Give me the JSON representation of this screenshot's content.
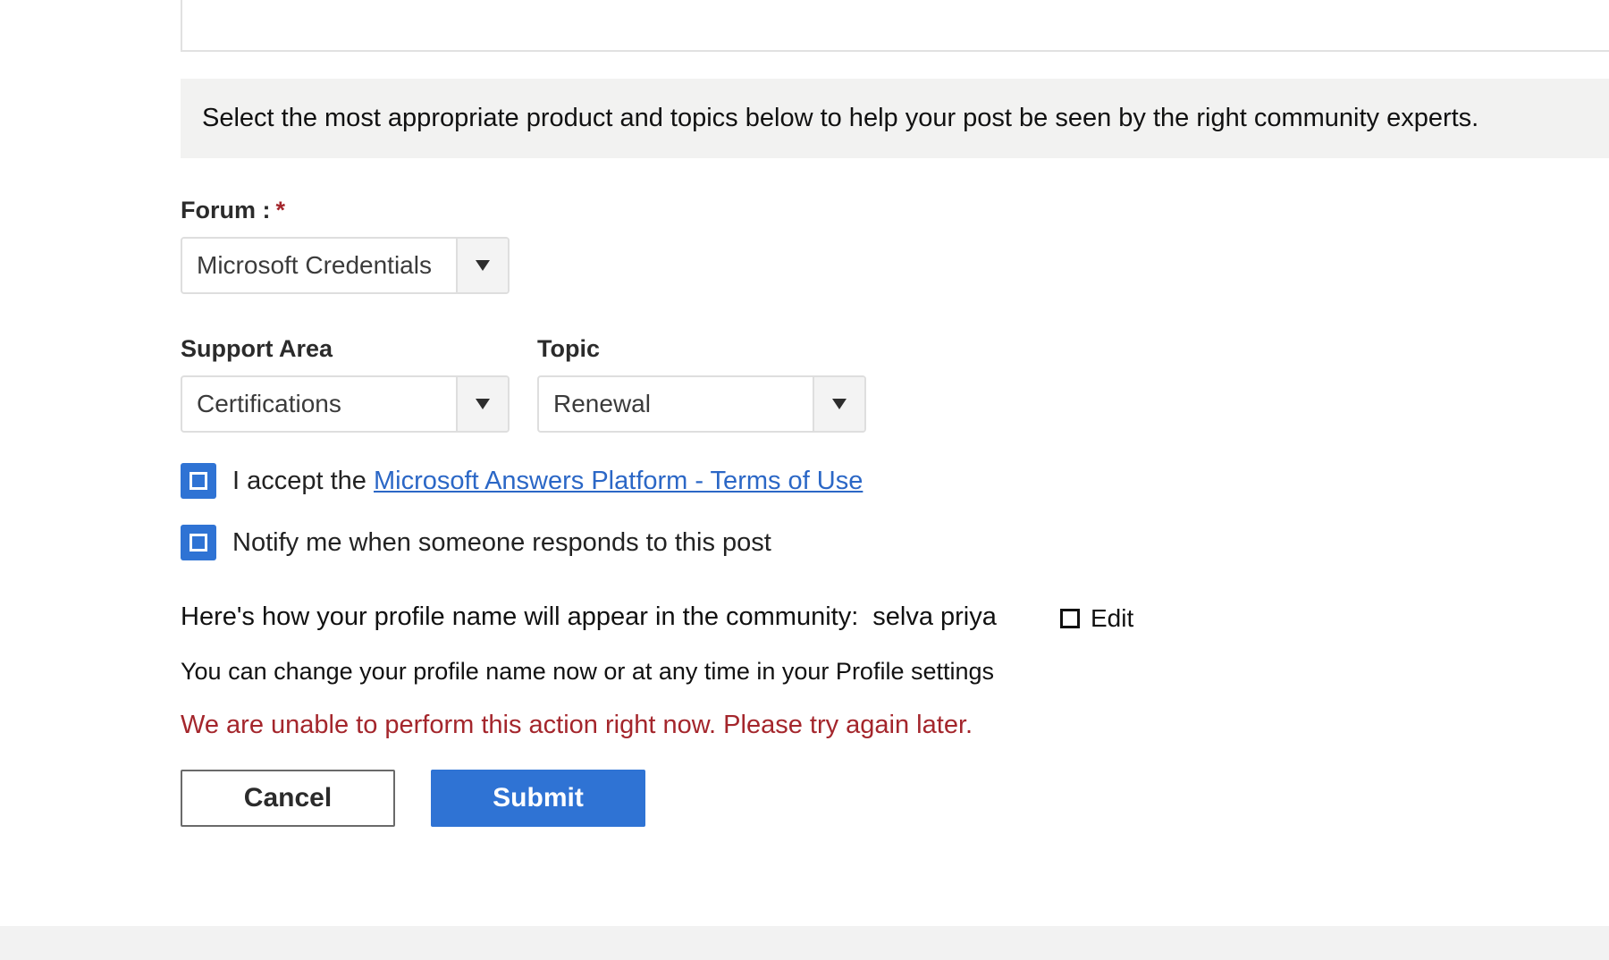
{
  "banner": {
    "text": "Select the most appropriate product and topics below to help your post be seen by the right community experts."
  },
  "forum": {
    "label": "Forum :",
    "required_mark": "*",
    "value": "Microsoft Credentials"
  },
  "support_area": {
    "label": "Support Area",
    "value": "Certifications"
  },
  "topic": {
    "label": "Topic",
    "value": "Renewal"
  },
  "terms": {
    "prefix": "I accept the",
    "link_text": "Microsoft Answers Platform - Terms of Use"
  },
  "notify": {
    "label": "Notify me when someone responds to this post"
  },
  "profile": {
    "intro": "Here's how your profile name will appear in the community:",
    "name": "selva priya",
    "edit_label": "Edit",
    "note": "You can change your profile name now or at any time in your Profile settings"
  },
  "error": {
    "message": "We are unable to perform this action right now. Please try again later."
  },
  "actions": {
    "cancel_label": "Cancel",
    "submit_label": "Submit"
  },
  "colors": {
    "accent": "#2f73d4",
    "error": "#a4262c",
    "link": "#2b67c6",
    "banner_bg": "#f2f2f1"
  }
}
